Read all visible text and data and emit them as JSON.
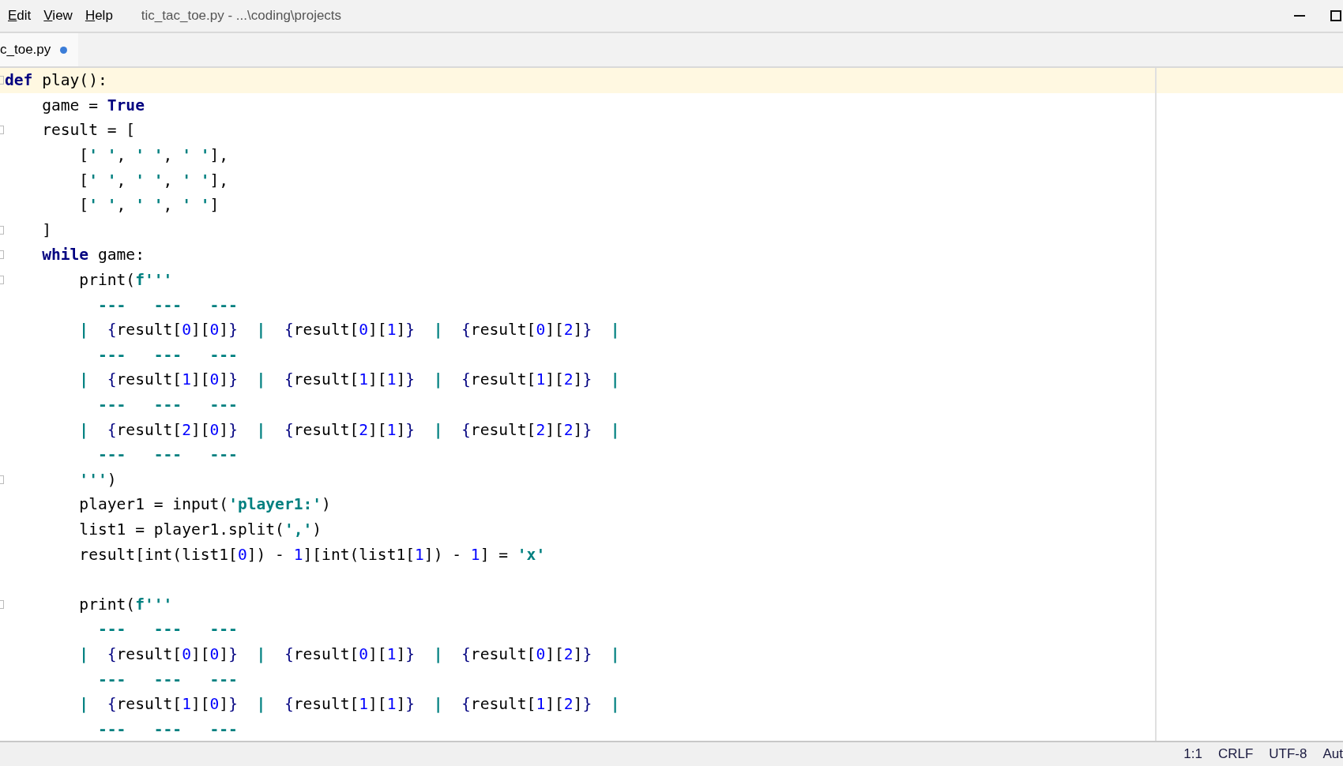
{
  "window": {
    "menu": [
      "Edit",
      "View",
      "Help"
    ],
    "title": "tic_tac_toe.py - ...\\coding\\projects"
  },
  "tabs": [
    {
      "label": "c_toe.py",
      "selected": true,
      "modified": true
    }
  ],
  "editor": {
    "lines": [
      {
        "fold": true,
        "current": true,
        "tokens": [
          {
            "kind": "keyword",
            "text": "def"
          },
          {
            "kind": "plain",
            "text": " play():"
          }
        ]
      },
      {
        "fold": false,
        "current": false,
        "tokens": [
          {
            "kind": "plain",
            "text": "    game = "
          },
          {
            "kind": "keyword",
            "text": "True"
          }
        ]
      },
      {
        "fold": true,
        "current": false,
        "tokens": [
          {
            "kind": "plain",
            "text": "    result = ["
          }
        ]
      },
      {
        "fold": false,
        "current": false,
        "tokens": [
          {
            "kind": "plain",
            "text": "        ["
          },
          {
            "kind": "string",
            "text": "' '"
          },
          {
            "kind": "plain",
            "text": ", "
          },
          {
            "kind": "string",
            "text": "' '"
          },
          {
            "kind": "plain",
            "text": ", "
          },
          {
            "kind": "string",
            "text": "' '"
          },
          {
            "kind": "plain",
            "text": "],"
          }
        ]
      },
      {
        "fold": false,
        "current": false,
        "tokens": [
          {
            "kind": "plain",
            "text": "        ["
          },
          {
            "kind": "string",
            "text": "' '"
          },
          {
            "kind": "plain",
            "text": ", "
          },
          {
            "kind": "string",
            "text": "' '"
          },
          {
            "kind": "plain",
            "text": ", "
          },
          {
            "kind": "string",
            "text": "' '"
          },
          {
            "kind": "plain",
            "text": "],"
          }
        ]
      },
      {
        "fold": false,
        "current": false,
        "tokens": [
          {
            "kind": "plain",
            "text": "        ["
          },
          {
            "kind": "string",
            "text": "' '"
          },
          {
            "kind": "plain",
            "text": ", "
          },
          {
            "kind": "string",
            "text": "' '"
          },
          {
            "kind": "plain",
            "text": ", "
          },
          {
            "kind": "string",
            "text": "' '"
          },
          {
            "kind": "plain",
            "text": "]"
          }
        ]
      },
      {
        "fold": true,
        "current": false,
        "tokens": [
          {
            "kind": "plain",
            "text": "    ]"
          }
        ]
      },
      {
        "fold": true,
        "current": false,
        "tokens": [
          {
            "kind": "keyword",
            "text": "    while"
          },
          {
            "kind": "plain",
            "text": " game:"
          }
        ]
      },
      {
        "fold": true,
        "current": false,
        "tokens": [
          {
            "kind": "plain",
            "text": "        print("
          },
          {
            "kind": "string",
            "text": "f'''"
          }
        ]
      },
      {
        "fold": false,
        "current": false,
        "tokens": [
          {
            "kind": "string",
            "text": "          ---   ---   ---"
          }
        ]
      },
      {
        "fold": false,
        "current": false,
        "tokens": [
          {
            "kind": "string",
            "text": "        |  "
          },
          {
            "kind": "brace",
            "text": "{"
          },
          {
            "kind": "plain",
            "text": "result["
          },
          {
            "kind": "number",
            "text": "0"
          },
          {
            "kind": "plain",
            "text": "]["
          },
          {
            "kind": "number",
            "text": "0"
          },
          {
            "kind": "plain",
            "text": "]"
          },
          {
            "kind": "brace",
            "text": "}"
          },
          {
            "kind": "string",
            "text": "  |  "
          },
          {
            "kind": "brace",
            "text": "{"
          },
          {
            "kind": "plain",
            "text": "result["
          },
          {
            "kind": "number",
            "text": "0"
          },
          {
            "kind": "plain",
            "text": "]["
          },
          {
            "kind": "number",
            "text": "1"
          },
          {
            "kind": "plain",
            "text": "]"
          },
          {
            "kind": "brace",
            "text": "}"
          },
          {
            "kind": "string",
            "text": "  |  "
          },
          {
            "kind": "brace",
            "text": "{"
          },
          {
            "kind": "plain",
            "text": "result["
          },
          {
            "kind": "number",
            "text": "0"
          },
          {
            "kind": "plain",
            "text": "]["
          },
          {
            "kind": "number",
            "text": "2"
          },
          {
            "kind": "plain",
            "text": "]"
          },
          {
            "kind": "brace",
            "text": "}"
          },
          {
            "kind": "string",
            "text": "  |"
          }
        ]
      },
      {
        "fold": false,
        "current": false,
        "tokens": [
          {
            "kind": "string",
            "text": "          ---   ---   ---"
          }
        ]
      },
      {
        "fold": false,
        "current": false,
        "tokens": [
          {
            "kind": "string",
            "text": "        |  "
          },
          {
            "kind": "brace",
            "text": "{"
          },
          {
            "kind": "plain",
            "text": "result["
          },
          {
            "kind": "number",
            "text": "1"
          },
          {
            "kind": "plain",
            "text": "]["
          },
          {
            "kind": "number",
            "text": "0"
          },
          {
            "kind": "plain",
            "text": "]"
          },
          {
            "kind": "brace",
            "text": "}"
          },
          {
            "kind": "string",
            "text": "  |  "
          },
          {
            "kind": "brace",
            "text": "{"
          },
          {
            "kind": "plain",
            "text": "result["
          },
          {
            "kind": "number",
            "text": "1"
          },
          {
            "kind": "plain",
            "text": "]["
          },
          {
            "kind": "number",
            "text": "1"
          },
          {
            "kind": "plain",
            "text": "]"
          },
          {
            "kind": "brace",
            "text": "}"
          },
          {
            "kind": "string",
            "text": "  |  "
          },
          {
            "kind": "brace",
            "text": "{"
          },
          {
            "kind": "plain",
            "text": "result["
          },
          {
            "kind": "number",
            "text": "1"
          },
          {
            "kind": "plain",
            "text": "]["
          },
          {
            "kind": "number",
            "text": "2"
          },
          {
            "kind": "plain",
            "text": "]"
          },
          {
            "kind": "brace",
            "text": "}"
          },
          {
            "kind": "string",
            "text": "  |"
          }
        ]
      },
      {
        "fold": false,
        "current": false,
        "tokens": [
          {
            "kind": "string",
            "text": "          ---   ---   ---"
          }
        ]
      },
      {
        "fold": false,
        "current": false,
        "tokens": [
          {
            "kind": "string",
            "text": "        |  "
          },
          {
            "kind": "brace",
            "text": "{"
          },
          {
            "kind": "plain",
            "text": "result["
          },
          {
            "kind": "number",
            "text": "2"
          },
          {
            "kind": "plain",
            "text": "]["
          },
          {
            "kind": "number",
            "text": "0"
          },
          {
            "kind": "plain",
            "text": "]"
          },
          {
            "kind": "brace",
            "text": "}"
          },
          {
            "kind": "string",
            "text": "  |  "
          },
          {
            "kind": "brace",
            "text": "{"
          },
          {
            "kind": "plain",
            "text": "result["
          },
          {
            "kind": "number",
            "text": "2"
          },
          {
            "kind": "plain",
            "text": "]["
          },
          {
            "kind": "number",
            "text": "1"
          },
          {
            "kind": "plain",
            "text": "]"
          },
          {
            "kind": "brace",
            "text": "}"
          },
          {
            "kind": "string",
            "text": "  |  "
          },
          {
            "kind": "brace",
            "text": "{"
          },
          {
            "kind": "plain",
            "text": "result["
          },
          {
            "kind": "number",
            "text": "2"
          },
          {
            "kind": "plain",
            "text": "]["
          },
          {
            "kind": "number",
            "text": "2"
          },
          {
            "kind": "plain",
            "text": "]"
          },
          {
            "kind": "brace",
            "text": "}"
          },
          {
            "kind": "string",
            "text": "  |"
          }
        ]
      },
      {
        "fold": false,
        "current": false,
        "tokens": [
          {
            "kind": "string",
            "text": "          ---   ---   ---"
          }
        ]
      },
      {
        "fold": true,
        "current": false,
        "tokens": [
          {
            "kind": "string",
            "text": "        '''"
          },
          {
            "kind": "plain",
            "text": ")"
          }
        ]
      },
      {
        "fold": false,
        "current": false,
        "tokens": [
          {
            "kind": "plain",
            "text": "        player1 = input("
          },
          {
            "kind": "string",
            "text": "'player1:'"
          },
          {
            "kind": "plain",
            "text": ")"
          }
        ]
      },
      {
        "fold": false,
        "current": false,
        "tokens": [
          {
            "kind": "plain",
            "text": "        list1 = player1.split("
          },
          {
            "kind": "string",
            "text": "','"
          },
          {
            "kind": "plain",
            "text": ")"
          }
        ]
      },
      {
        "fold": false,
        "current": false,
        "tokens": [
          {
            "kind": "plain",
            "text": "        result[int(list1["
          },
          {
            "kind": "number",
            "text": "0"
          },
          {
            "kind": "plain",
            "text": "]) - "
          },
          {
            "kind": "number",
            "text": "1"
          },
          {
            "kind": "plain",
            "text": "][int(list1["
          },
          {
            "kind": "number",
            "text": "1"
          },
          {
            "kind": "plain",
            "text": "]) - "
          },
          {
            "kind": "number",
            "text": "1"
          },
          {
            "kind": "plain",
            "text": "] = "
          },
          {
            "kind": "string",
            "text": "'x'"
          }
        ]
      },
      {
        "fold": false,
        "current": false
      },
      {
        "fold": true,
        "current": false,
        "tokens": [
          {
            "kind": "plain",
            "text": "        print("
          },
          {
            "kind": "string",
            "text": "f'''"
          }
        ]
      },
      {
        "fold": false,
        "current": false,
        "tokens": [
          {
            "kind": "string",
            "text": "          ---   ---   ---"
          }
        ]
      },
      {
        "fold": false,
        "current": false,
        "tokens": [
          {
            "kind": "string",
            "text": "        |  "
          },
          {
            "kind": "brace",
            "text": "{"
          },
          {
            "kind": "plain",
            "text": "result["
          },
          {
            "kind": "number",
            "text": "0"
          },
          {
            "kind": "plain",
            "text": "]["
          },
          {
            "kind": "number",
            "text": "0"
          },
          {
            "kind": "plain",
            "text": "]"
          },
          {
            "kind": "brace",
            "text": "}"
          },
          {
            "kind": "string",
            "text": "  |  "
          },
          {
            "kind": "brace",
            "text": "{"
          },
          {
            "kind": "plain",
            "text": "result["
          },
          {
            "kind": "number",
            "text": "0"
          },
          {
            "kind": "plain",
            "text": "]["
          },
          {
            "kind": "number",
            "text": "1"
          },
          {
            "kind": "plain",
            "text": "]"
          },
          {
            "kind": "brace",
            "text": "}"
          },
          {
            "kind": "string",
            "text": "  |  "
          },
          {
            "kind": "brace",
            "text": "{"
          },
          {
            "kind": "plain",
            "text": "result["
          },
          {
            "kind": "number",
            "text": "0"
          },
          {
            "kind": "plain",
            "text": "]["
          },
          {
            "kind": "number",
            "text": "2"
          },
          {
            "kind": "plain",
            "text": "]"
          },
          {
            "kind": "brace",
            "text": "}"
          },
          {
            "kind": "string",
            "text": "  |"
          }
        ]
      },
      {
        "fold": false,
        "current": false,
        "tokens": [
          {
            "kind": "string",
            "text": "          ---   ---   ---"
          }
        ]
      },
      {
        "fold": false,
        "current": false,
        "tokens": [
          {
            "kind": "string",
            "text": "        |  "
          },
          {
            "kind": "brace",
            "text": "{"
          },
          {
            "kind": "plain",
            "text": "result["
          },
          {
            "kind": "number",
            "text": "1"
          },
          {
            "kind": "plain",
            "text": "]["
          },
          {
            "kind": "number",
            "text": "0"
          },
          {
            "kind": "plain",
            "text": "]"
          },
          {
            "kind": "brace",
            "text": "}"
          },
          {
            "kind": "string",
            "text": "  |  "
          },
          {
            "kind": "brace",
            "text": "{"
          },
          {
            "kind": "plain",
            "text": "result["
          },
          {
            "kind": "number",
            "text": "1"
          },
          {
            "kind": "plain",
            "text": "]["
          },
          {
            "kind": "number",
            "text": "1"
          },
          {
            "kind": "plain",
            "text": "]"
          },
          {
            "kind": "brace",
            "text": "}"
          },
          {
            "kind": "string",
            "text": "  |  "
          },
          {
            "kind": "brace",
            "text": "{"
          },
          {
            "kind": "plain",
            "text": "result["
          },
          {
            "kind": "number",
            "text": "1"
          },
          {
            "kind": "plain",
            "text": "]["
          },
          {
            "kind": "number",
            "text": "2"
          },
          {
            "kind": "plain",
            "text": "]"
          },
          {
            "kind": "brace",
            "text": "}"
          },
          {
            "kind": "string",
            "text": "  |"
          }
        ]
      },
      {
        "fold": false,
        "current": false,
        "tokens": [
          {
            "kind": "string",
            "text": "          ---   ---   ---"
          }
        ]
      }
    ]
  },
  "status_bar": [
    "1:1",
    "CRLF",
    "UTF-8",
    "Aut"
  ]
}
